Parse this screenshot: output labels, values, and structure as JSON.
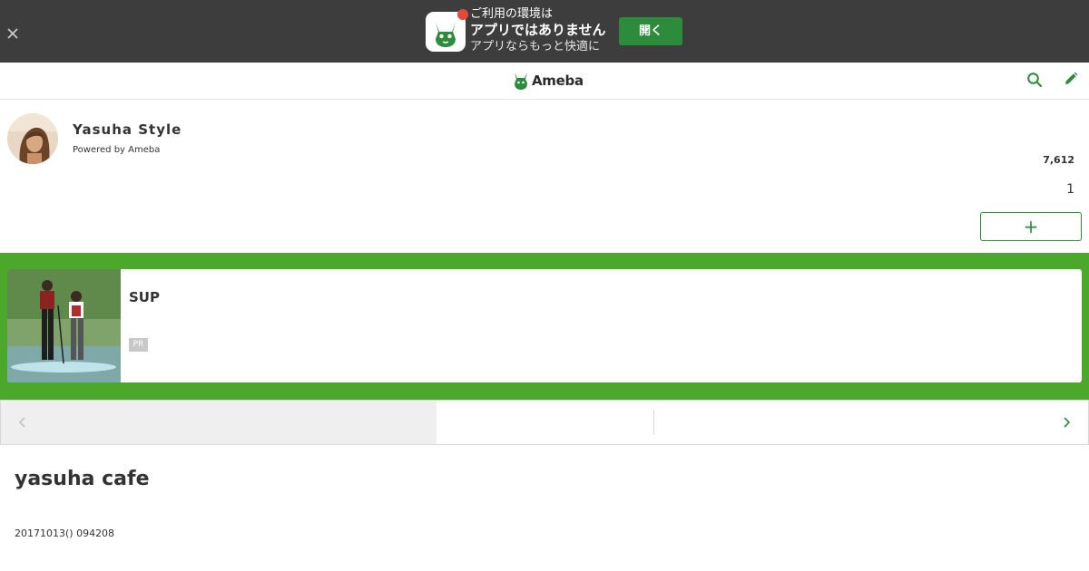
{
  "app_banner": {
    "line1": "ご利用の環境は",
    "line2": "アプリではありません",
    "line3": "アプリならもっと快適に",
    "open_label": "開く"
  },
  "header": {
    "logo_text": "Ameba"
  },
  "blog": {
    "title": "Yasuha Style",
    "powered_by": "Powered by Ameba",
    "reader_count": "7,612",
    "follow_count": "1",
    "follow_label": "+"
  },
  "ad": {
    "title": "SUP",
    "badge": "PR"
  },
  "article": {
    "title": "yasuha cafe",
    "date": "20171013() 094208"
  },
  "colors": {
    "banner_bg": "#3d3d3d",
    "brand_green": "#2d8c3c",
    "ad_bg": "#4ca82b",
    "badge_red": "#e8483a"
  },
  "icons": {
    "close": "close-icon",
    "search": "search-icon",
    "edit": "pencil-icon",
    "prev": "chevron-left-icon",
    "next": "chevron-right-icon"
  }
}
